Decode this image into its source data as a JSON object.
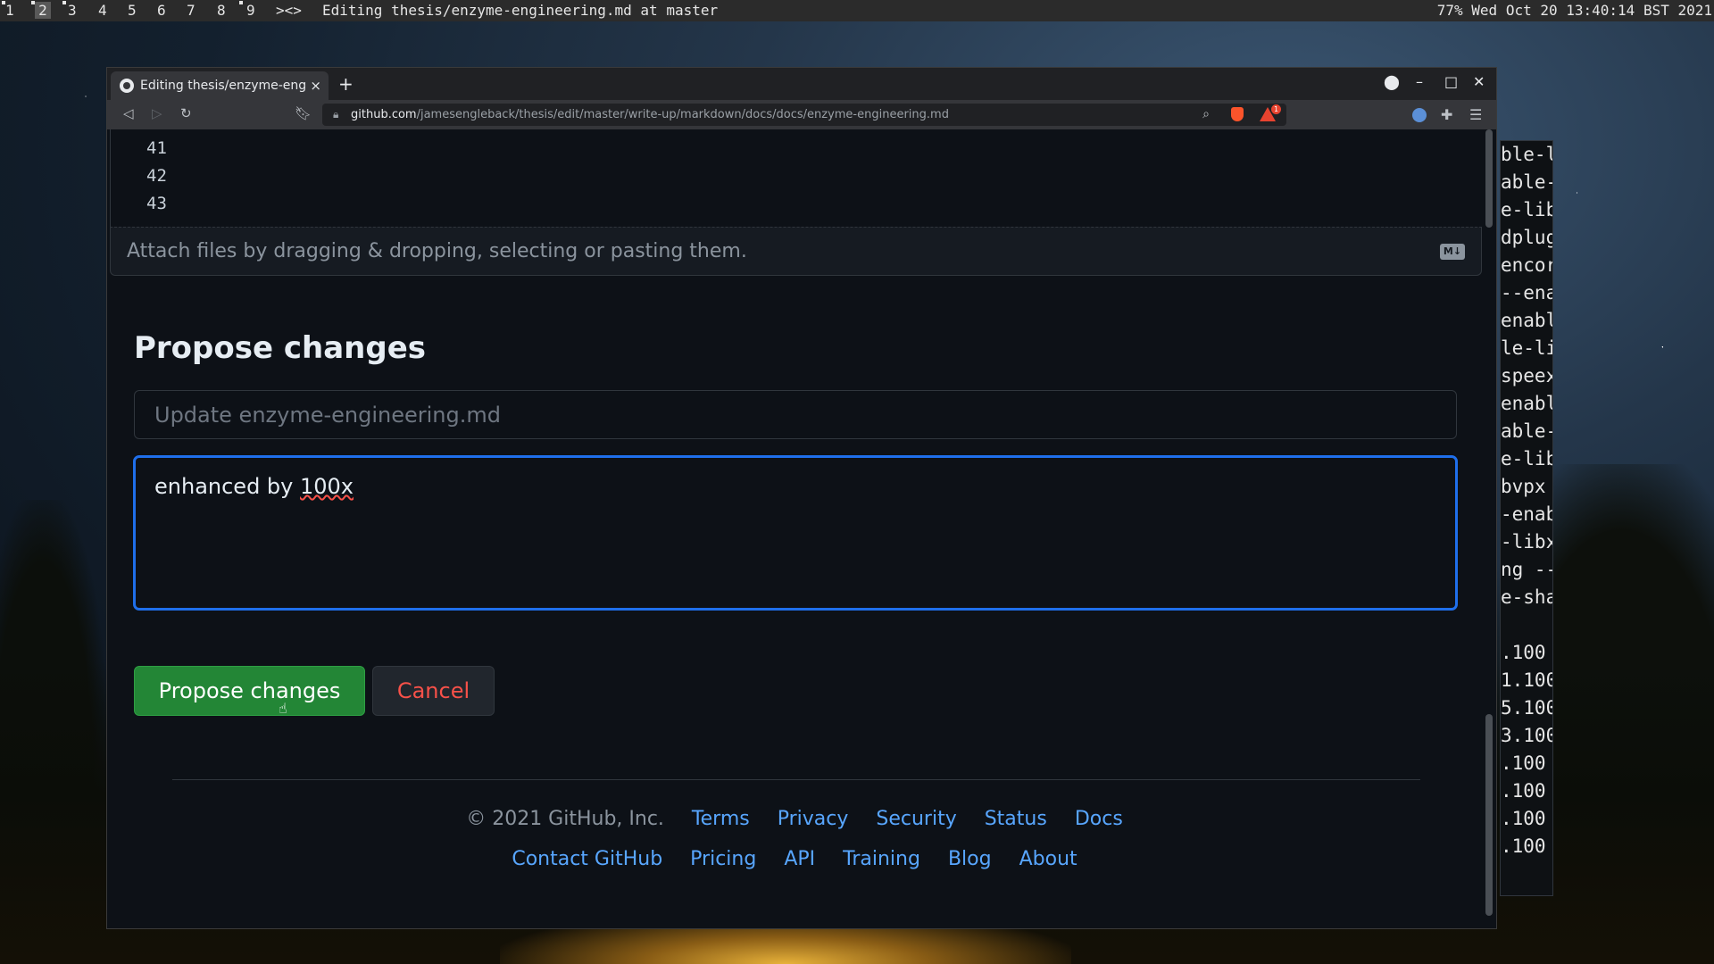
{
  "topbar": {
    "workspaces": [
      "1",
      "2",
      "3",
      "4",
      "5",
      "6",
      "7",
      "8",
      "9"
    ],
    "active_workspace": "2",
    "overflow": "><>",
    "window_title": "Editing thesis/enzyme-engineering.md at master",
    "status": "77% Wed Oct 20 13:40:14 BST 2021"
  },
  "terminal": {
    "lines": [
      "ble-l",
      "able-",
      "e-lib",
      "dplug",
      "encor",
      "--ena",
      "enabl",
      "le-li",
      "speex",
      "enabl",
      "able-",
      "e-lib",
      "bvpx",
      "-enab",
      "-libx",
      "ng --",
      "e-sha"
    ],
    "lines2": [
      ".100",
      "1.100",
      "5.100",
      "3.100",
      ".100",
      ".100",
      ".100",
      ".100"
    ]
  },
  "browser": {
    "tab_title": "Editing thesis/enzyme-eng",
    "tab_close": "×",
    "new_tab": "+",
    "url_host": "github.com",
    "url_path": "/jamesengleback/thesis/edit/master/write-up/markdown/docs/docs/enzyme-engineering.md",
    "rewards_badge": "1"
  },
  "editor": {
    "line_numbers": [
      "41",
      "42",
      "43"
    ],
    "attach_hint": "Attach files by dragging & dropping, selecting or pasting them.",
    "markdown_badge": "M↓"
  },
  "commit": {
    "heading": "Propose changes",
    "summary_placeholder": "Update enzyme-engineering.md",
    "description_prefix": "enhanced by ",
    "description_flagged": "100x",
    "submit_label": "Propose changes",
    "cancel_label": "Cancel"
  },
  "footer": {
    "copyright": "© 2021 GitHub, Inc.",
    "row1": [
      "Terms",
      "Privacy",
      "Security",
      "Status",
      "Docs"
    ],
    "row2": [
      "Contact GitHub",
      "Pricing",
      "API",
      "Training",
      "Blog",
      "About"
    ]
  },
  "colors": {
    "accent_blue": "#1f6feb",
    "link_blue": "#58a6ff",
    "submit_green": "#238636",
    "cancel_red": "#f85149"
  }
}
